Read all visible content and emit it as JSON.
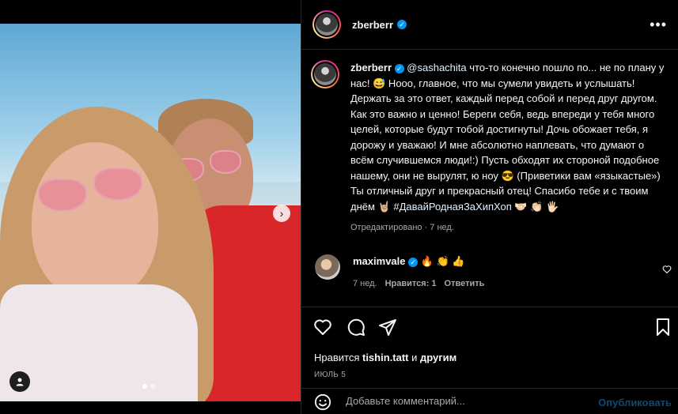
{
  "post": {
    "author": "zberberr",
    "caption_author": "zberberr",
    "mention": "@sashachita",
    "caption_text": " что-то конечно пошло по... не по плану у нас! 😅 Нооо, главное, что мы сумели увидеть и услышать! Держать за это ответ, каждый перед собой и перед друг другом. Как это важно и ценно! Береги себя, ведь впереди у тебя много целей, которые будут тобой достигнуты! Дочь обожает тебя, я дорожу и уважаю! И мне абсолютно наплевать, что думают о всём случившемся люди!:) Пусть обходят их стороной подобное нашему, они не вырулят, ю ноу 😎 (Приветики вам «языкастые») Ты отличный друг и прекрасный отец! Спасибо тебе и с твоим днём 🤘🏼 ",
    "hashtag": "#ДавайРоднаяЗаХипХоп",
    "caption_tail": " 🤝🏻 👏🏻 🖐🏻",
    "edited_label": "Отредактировано · 7 нед."
  },
  "comment": {
    "username": "maximvale",
    "text": " 🔥 👏 👍",
    "age": "7 нед.",
    "likes": "Нравится: 1",
    "reply": "Ответить"
  },
  "likes_line": {
    "prefix": "Нравится ",
    "user": "tishin.tatt",
    "suffix": " и ",
    "others": "другим"
  },
  "date": "ИЮЛЬ 5",
  "comment_box": {
    "placeholder": "Добавьте комментарий...",
    "publish": "Опубликовать"
  },
  "icons": {
    "more": "more-icon",
    "like": "heart-icon",
    "comment": "comment-icon",
    "share": "share-icon",
    "save": "bookmark-icon",
    "emoji": "emoji-icon",
    "next": "chevron-right-icon",
    "tag": "user-tag-icon"
  },
  "colors": {
    "link": "#0095f6",
    "verified": "#0095f6",
    "muted": "#a8a8a8"
  }
}
